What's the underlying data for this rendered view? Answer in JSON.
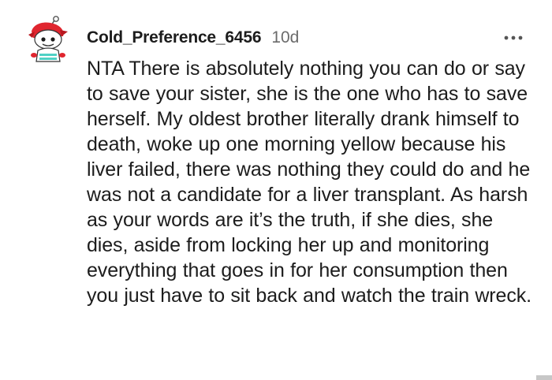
{
  "comment": {
    "username": "Cold_Preference_6456",
    "age": "10d",
    "more_icon": "more-horizontal-icon",
    "avatar_icon": "snoo-avatar-icon",
    "body": "NTA There is absolutely nothing you can do or say to save your sister, she is the one who has to save herself. My oldest brother literally drank himself to death, woke up one morning yellow because his liver failed, there was nothing they could do and he was not a candidate for a liver transplant. As harsh as your words are it’s the truth, if she dies, she dies, aside from locking her up and monitoring everything that goes in for her consumption then you just have to sit back and watch the train wreck."
  },
  "colors": {
    "text": "#1c1c1c",
    "meta": "#6b6b6b",
    "avatar_accent": "#e0262f",
    "avatar_teal": "#4fd1c5"
  }
}
